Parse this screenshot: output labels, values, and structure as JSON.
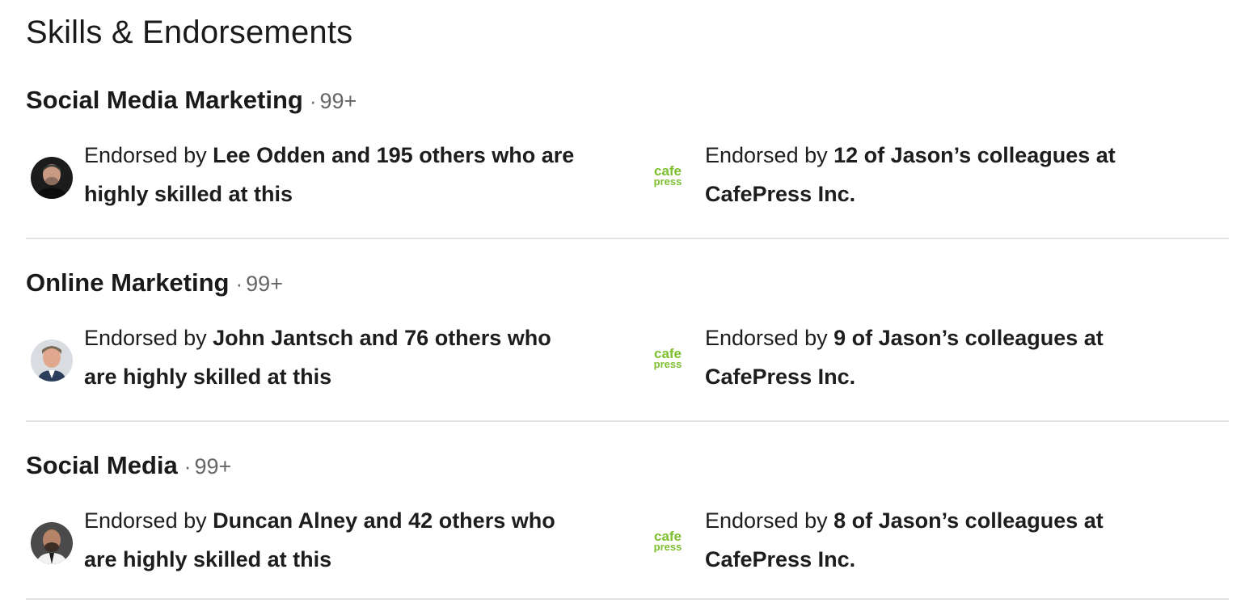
{
  "section": {
    "title": "Skills & Endorsements"
  },
  "skills": [
    {
      "name": "Social Media Marketing",
      "dot": "·",
      "count": "99+",
      "people": {
        "prefix": "Endorsed by",
        "line1_bold": "Lee Odden and 195 others who are",
        "line2_bold": "highly skilled at this"
      },
      "colleagues": {
        "prefix": "Endorsed by",
        "line1_bold": "12 of Jason’s colleagues at",
        "line2_bold": "CafePress Inc."
      }
    },
    {
      "name": "Online Marketing",
      "dot": "·",
      "count": "99+",
      "people": {
        "prefix": "Endorsed by",
        "line1_bold": "John Jantsch and 76 others who",
        "line2_bold": "are highly skilled at this"
      },
      "colleagues": {
        "prefix": "Endorsed by",
        "line1_bold": "9 of Jason’s colleagues at",
        "line2_bold": "CafePress Inc."
      }
    },
    {
      "name": "Social Media",
      "dot": "·",
      "count": "99+",
      "people": {
        "prefix": "Endorsed by",
        "line1_bold": "Duncan Alney and 42 others who",
        "line2_bold": "are highly skilled at this"
      },
      "colleagues": {
        "prefix": "Endorsed by",
        "line1_bold": "8 of Jason’s colleagues at",
        "line2_bold": "CafePress Inc."
      }
    }
  ],
  "logo": {
    "line1": "cafe",
    "line2": "press",
    "color": "#7dbf2e"
  }
}
